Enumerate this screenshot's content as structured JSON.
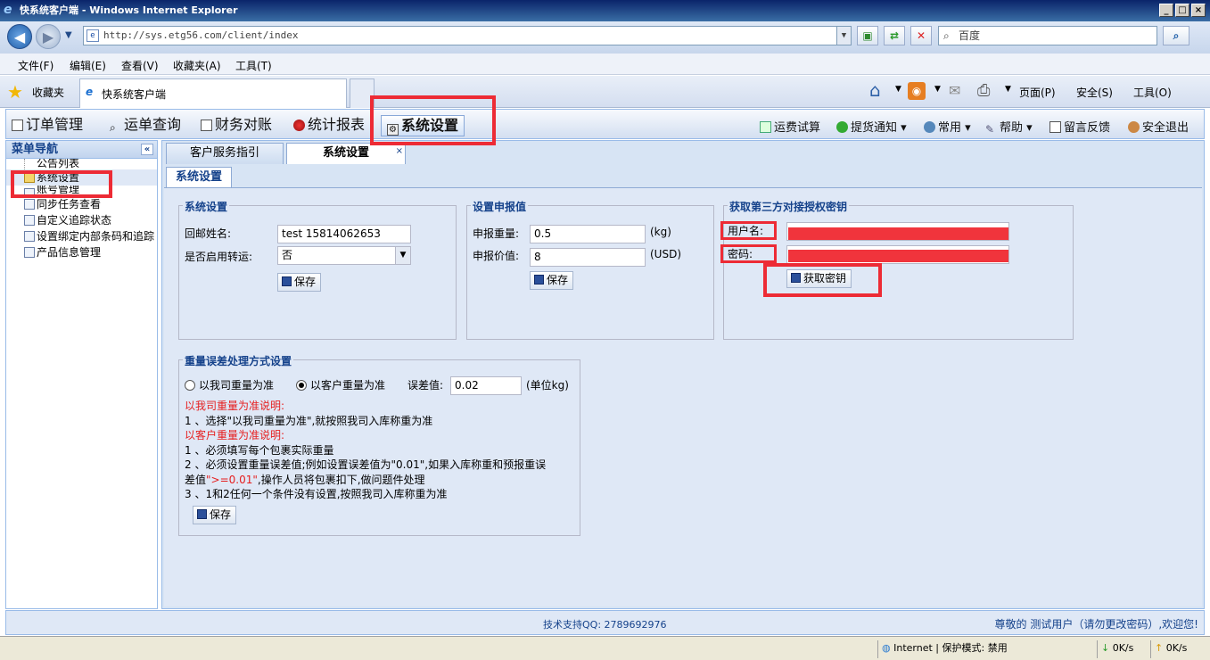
{
  "window": {
    "title": "快系统客户端 - Windows Internet Explorer"
  },
  "address": {
    "url": "http://sys.etg56.com/client/index",
    "search_placeholder": "百度"
  },
  "menubar": [
    "文件(F)",
    "编辑(E)",
    "查看(V)",
    "收藏夹(A)",
    "工具(T)"
  ],
  "favbar": {
    "favorites": "收藏夹",
    "tab_title": "快系统客户端",
    "page": "页面(P)",
    "safety": "安全(S)",
    "tools": "工具(O)"
  },
  "app_tabs": [
    "订单管理",
    "运单查询",
    "财务对账",
    "统计报表",
    "系统设置"
  ],
  "top_right": [
    "运费试算",
    "提货通知",
    "常用",
    "帮助",
    "留言反馈",
    "安全退出"
  ],
  "sidebar": {
    "title": "菜单导航",
    "items": [
      "公告列表",
      "系统设置",
      "账号管理",
      "同步任务查看",
      "自定义追踪状态",
      "设置绑定内部条码和追踪",
      "产品信息管理"
    ]
  },
  "content_tabs": [
    "客户服务指引",
    "系统设置"
  ],
  "subtab": "系统设置",
  "sys_settings": {
    "legend": "系统设置",
    "return_name_label": "回邮姓名:",
    "return_name_value": "test 15814062653",
    "transfer_label": "是否启用转运:",
    "transfer_value": "否",
    "save": "保存"
  },
  "declare": {
    "legend": "设置申报值",
    "weight_label": "申报重量:",
    "weight_value": "0.5",
    "weight_unit": "(kg)",
    "value_label": "申报价值:",
    "value_value": "8",
    "value_unit": "(USD)",
    "save": "保存"
  },
  "auth": {
    "legend": "获取第三方对接授权密钥",
    "username_label": "用户名:",
    "password_label": "密码:",
    "get_key": "获取密钥"
  },
  "weight_error": {
    "legend": "重量误差处理方式设置",
    "option1": "以我司重量为准",
    "option2": "以客户重量为准",
    "selected": "以客户重量为准",
    "tolerance_label": "误差值:",
    "tolerance_value": "0.02",
    "tolerance_unit": "(单位kg)",
    "note1_title": "以我司重量为准说明:",
    "note1_line1": "1 、选择\"以我司重量为准\",就按照我司入库称重为准",
    "note2_title": "以客户重量为准说明:",
    "note2_line1": "1 、必须填写每个包裹实际重量",
    "note2_line2": "2 、必须设置重量误差值;例如设置误差值为\"0.01\",如果入库称重和预报重误",
    "note2_line3a": "差值",
    "note2_line3b": "\">=0.01\"",
    "note2_line3c": ",操作人员将包裹扣下,做问题件处理",
    "note2_line4": "3 、1和2任何一个条件没有设置,按照我司入库称重为准",
    "save": "保存"
  },
  "footer": {
    "support": "技术支持QQ: 2789692976",
    "welcome": "尊敬的 测试用户（请勿更改密码）,欢迎您!"
  },
  "status": {
    "zone": "Internet | 保护模式: 禁用",
    "down": "0K/s",
    "up": "0K/s"
  }
}
